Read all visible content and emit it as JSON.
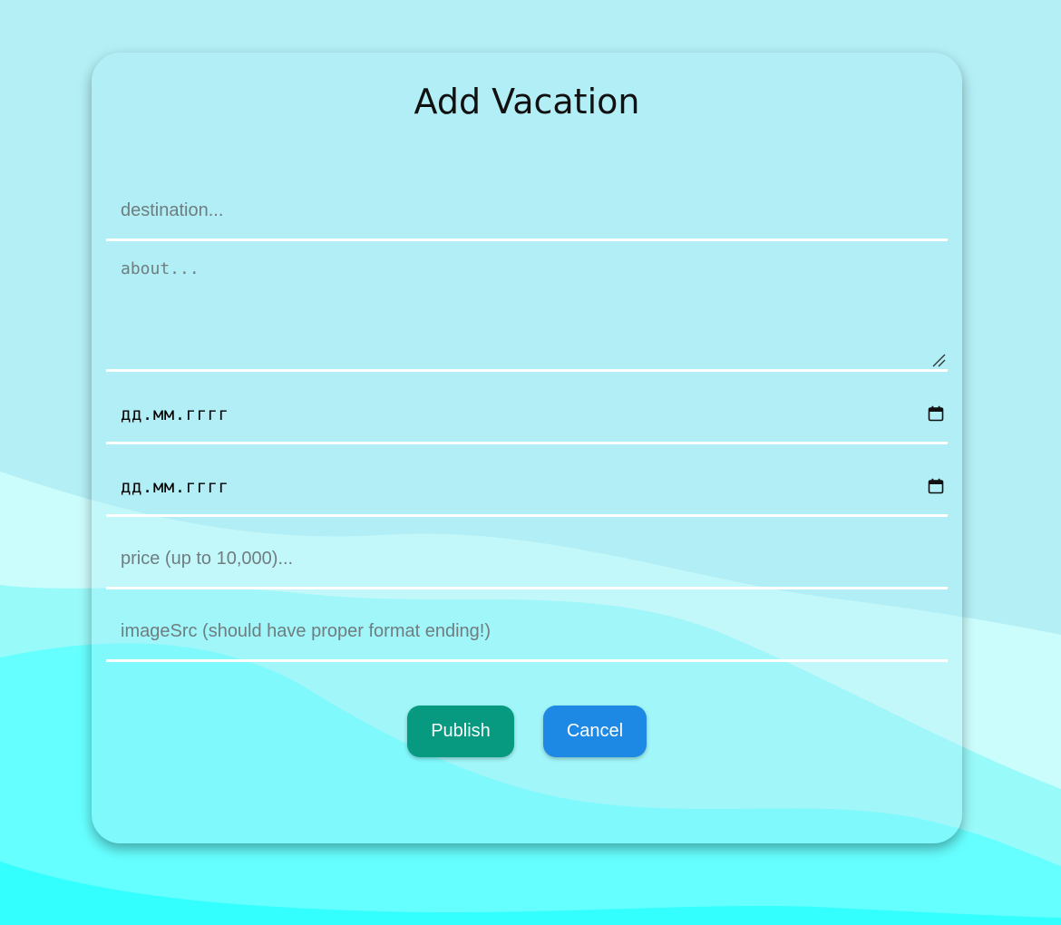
{
  "form": {
    "title": "Add Vacation",
    "destination_placeholder": "destination...",
    "about_placeholder": "about...",
    "start_date_placeholder": "дд.мм.гггг",
    "end_date_placeholder": "дд.мм.гггг",
    "price_placeholder": "price (up to 10,000)...",
    "image_placeholder": "imageSrc (should have proper format ending!)",
    "publish_label": "Publish",
    "cancel_label": "Cancel"
  },
  "icons": {
    "calendar": "calendar-icon",
    "resize": "resize-handle-icon"
  },
  "colors": {
    "background": "#b3eff5",
    "wave_light": "#ccfdfd",
    "wave_mid": "#99fafa",
    "wave_strong": "#66ffff",
    "publish": "#079a80",
    "cancel": "#1e88e5",
    "field_underline": "#ffffff"
  }
}
